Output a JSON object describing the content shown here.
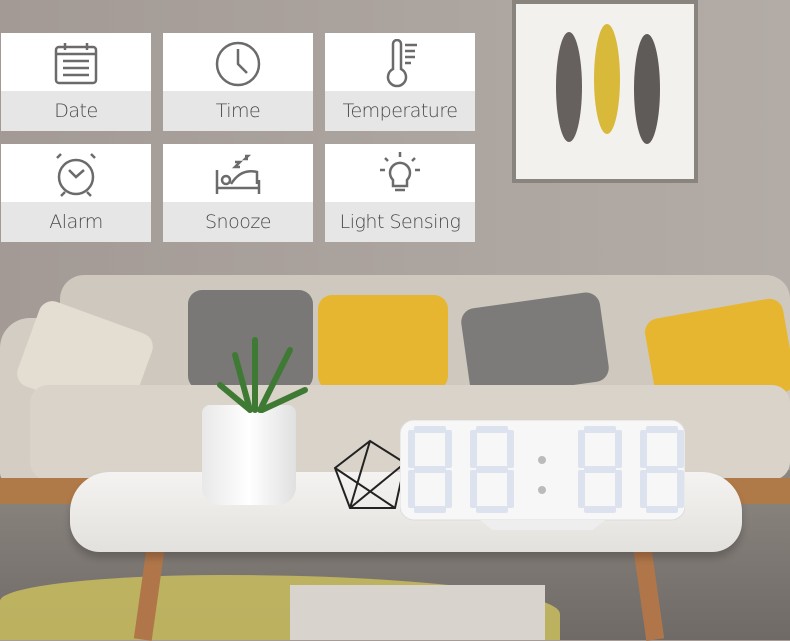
{
  "features": [
    {
      "label": "Date",
      "icon": "calendar-icon"
    },
    {
      "label": "Time",
      "icon": "clock-icon"
    },
    {
      "label": "Temperature",
      "icon": "thermometer-icon"
    },
    {
      "label": "Alarm",
      "icon": "alarm-clock-icon"
    },
    {
      "label": "Snooze",
      "icon": "sleeping-bed-icon"
    },
    {
      "label": "Light Sensing",
      "icon": "light-bulb-icon"
    }
  ],
  "colors": {
    "tile_bg": "#ffffff",
    "label_bg": "#e6e6e6",
    "icon": "#6b6b6b",
    "text": "#4a4a4a"
  }
}
